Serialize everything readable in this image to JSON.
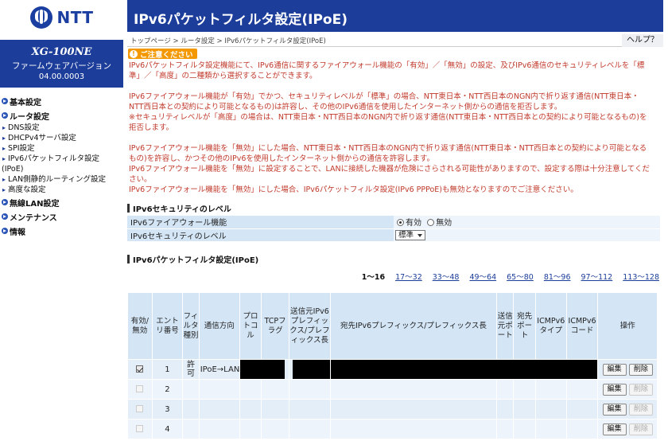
{
  "logo": {
    "text": "NTT"
  },
  "device": {
    "model": "XG-100NE",
    "firmware_label": "ファームウェアバージョン",
    "firmware_version": "04.00.0003"
  },
  "nav": {
    "basic": "基本設定",
    "router": "ルータ設定",
    "dns": "DNS設定",
    "dhcp": "DHCPv4サーバ設定",
    "spi": "SPI設定",
    "ipv6filter_a": "IPv6パケットフィルタ設定",
    "ipv6filter_b": "(IPoE)",
    "lan_routing": "LAN側静的ルーティング設定",
    "advanced": "高度な設定",
    "wlan": "無線LAN設定",
    "maintenance": "メンテナンス",
    "info": "情報"
  },
  "page": {
    "title": "IPv6パケットフィルタ設定(IPoE)",
    "breadcrumb": "トップページ > ルータ設定 > IPv6パケットフィルタ設定(IPoE)",
    "help": "ヘルプ？"
  },
  "caution": {
    "badge": "ご注意ください",
    "p1": [
      "IPv6パケットフィルタ設定機能にて、IPv6通信に関するファイアウォール機能の「有効」／「無効」の設定、及びIPv6通信のセキュリティレベルを「標",
      "準」／「高度」の二種類から選択することができます。"
    ],
    "p2": [
      "IPv6ファイアウォール機能が「有効」でかつ、セキュリティレベルが「標準」の場合、NTT東日本・NTT西日本のNGN内で折り返す通信(NTT東日本・",
      "NTT西日本との契約により可能となるもの)は許容し、その他のIPv6通信を使用したインターネット側からの通信を拒否します。",
      "※セキュリティレベルが「高度」の場合は、NTT東日本・NTT西日本のNGN内で折り返す通信(NTT東日本・NTT西日本との契約により可能となるもの)を",
      "拒否します。"
    ],
    "p3": [
      "IPv6ファイアウォール機能を「無効」にした場合、NTT東日本・NTT西日本のNGN内で折り返す通信(NTT東日本・NTT西日本との契約により可能となる",
      "もの)を許容し、かつその他のIPv6を使用したインターネット側からの通信を許容します。",
      "IPv6ファイアウォール機能を「無効」に設定することで、LANに接続した機器が危険にさらされる可能性がありますので、設定する際は十分注意してくだ",
      "さい。",
      "IPv6ファイアウォール機能を「無効」にした場合、IPv6パケットフィルタ設定(IPv6 PPPoE)も無効となりますのでご注意ください。"
    ]
  },
  "security": {
    "heading": "IPv6セキュリティのレベル",
    "firewall_label": "IPv6ファイアウォール機能",
    "enable": "有効",
    "disable": "無効",
    "level_label": "IPv6セキュリティのレベル",
    "level_value": "標準"
  },
  "filter": {
    "heading": "IPv6パケットフィルタ設定(IPoE)",
    "pager": [
      "1～16",
      "17～32",
      "33～48",
      "49～64",
      "65～80",
      "81～96",
      "97～112",
      "113～128"
    ],
    "columns": {
      "enabled": "有効/無効",
      "entry": "エントリ番号",
      "filter_type": "フィルタ種別",
      "direction": "通信方向",
      "protocol": "プロトコル",
      "tcp_flag": "TCPフラグ",
      "src_prefix": "送信元IPv6プレフィックス/プレフィックス長",
      "dst_prefix": "宛先IPv6プレフィックス/プレフィックス長",
      "src_port": "送信元ポート",
      "dst_port": "宛先ポート",
      "icmp_type": "ICMPv6タイプ",
      "icmp_code": "ICMPv6コード",
      "action": "操作"
    },
    "edit": "編集",
    "delete": "削除",
    "rows": [
      {
        "no": "1",
        "type": "許可",
        "direction": "IPoE→LAN"
      },
      {
        "no": "2",
        "type": "",
        "direction": ""
      },
      {
        "no": "3",
        "type": "",
        "direction": ""
      },
      {
        "no": "4",
        "type": "",
        "direction": ""
      }
    ]
  }
}
